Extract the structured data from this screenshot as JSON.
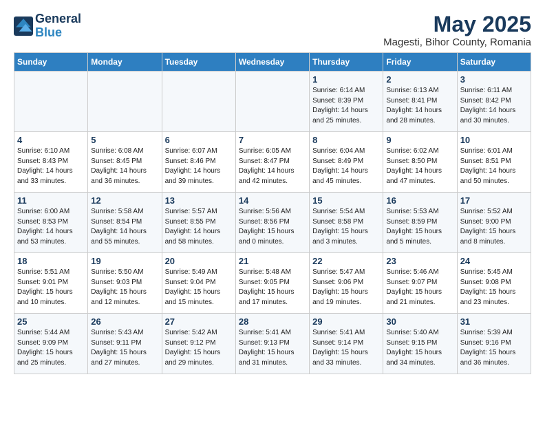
{
  "header": {
    "logo_line1": "General",
    "logo_line2": "Blue",
    "title": "May 2025",
    "subtitle": "Magesti, Bihor County, Romania"
  },
  "weekdays": [
    "Sunday",
    "Monday",
    "Tuesday",
    "Wednesday",
    "Thursday",
    "Friday",
    "Saturday"
  ],
  "weeks": [
    [
      {
        "num": "",
        "info": ""
      },
      {
        "num": "",
        "info": ""
      },
      {
        "num": "",
        "info": ""
      },
      {
        "num": "",
        "info": ""
      },
      {
        "num": "1",
        "info": "Sunrise: 6:14 AM\nSunset: 8:39 PM\nDaylight: 14 hours\nand 25 minutes."
      },
      {
        "num": "2",
        "info": "Sunrise: 6:13 AM\nSunset: 8:41 PM\nDaylight: 14 hours\nand 28 minutes."
      },
      {
        "num": "3",
        "info": "Sunrise: 6:11 AM\nSunset: 8:42 PM\nDaylight: 14 hours\nand 30 minutes."
      }
    ],
    [
      {
        "num": "4",
        "info": "Sunrise: 6:10 AM\nSunset: 8:43 PM\nDaylight: 14 hours\nand 33 minutes."
      },
      {
        "num": "5",
        "info": "Sunrise: 6:08 AM\nSunset: 8:45 PM\nDaylight: 14 hours\nand 36 minutes."
      },
      {
        "num": "6",
        "info": "Sunrise: 6:07 AM\nSunset: 8:46 PM\nDaylight: 14 hours\nand 39 minutes."
      },
      {
        "num": "7",
        "info": "Sunrise: 6:05 AM\nSunset: 8:47 PM\nDaylight: 14 hours\nand 42 minutes."
      },
      {
        "num": "8",
        "info": "Sunrise: 6:04 AM\nSunset: 8:49 PM\nDaylight: 14 hours\nand 45 minutes."
      },
      {
        "num": "9",
        "info": "Sunrise: 6:02 AM\nSunset: 8:50 PM\nDaylight: 14 hours\nand 47 minutes."
      },
      {
        "num": "10",
        "info": "Sunrise: 6:01 AM\nSunset: 8:51 PM\nDaylight: 14 hours\nand 50 minutes."
      }
    ],
    [
      {
        "num": "11",
        "info": "Sunrise: 6:00 AM\nSunset: 8:53 PM\nDaylight: 14 hours\nand 53 minutes."
      },
      {
        "num": "12",
        "info": "Sunrise: 5:58 AM\nSunset: 8:54 PM\nDaylight: 14 hours\nand 55 minutes."
      },
      {
        "num": "13",
        "info": "Sunrise: 5:57 AM\nSunset: 8:55 PM\nDaylight: 14 hours\nand 58 minutes."
      },
      {
        "num": "14",
        "info": "Sunrise: 5:56 AM\nSunset: 8:56 PM\nDaylight: 15 hours\nand 0 minutes."
      },
      {
        "num": "15",
        "info": "Sunrise: 5:54 AM\nSunset: 8:58 PM\nDaylight: 15 hours\nand 3 minutes."
      },
      {
        "num": "16",
        "info": "Sunrise: 5:53 AM\nSunset: 8:59 PM\nDaylight: 15 hours\nand 5 minutes."
      },
      {
        "num": "17",
        "info": "Sunrise: 5:52 AM\nSunset: 9:00 PM\nDaylight: 15 hours\nand 8 minutes."
      }
    ],
    [
      {
        "num": "18",
        "info": "Sunrise: 5:51 AM\nSunset: 9:01 PM\nDaylight: 15 hours\nand 10 minutes."
      },
      {
        "num": "19",
        "info": "Sunrise: 5:50 AM\nSunset: 9:03 PM\nDaylight: 15 hours\nand 12 minutes."
      },
      {
        "num": "20",
        "info": "Sunrise: 5:49 AM\nSunset: 9:04 PM\nDaylight: 15 hours\nand 15 minutes."
      },
      {
        "num": "21",
        "info": "Sunrise: 5:48 AM\nSunset: 9:05 PM\nDaylight: 15 hours\nand 17 minutes."
      },
      {
        "num": "22",
        "info": "Sunrise: 5:47 AM\nSunset: 9:06 PM\nDaylight: 15 hours\nand 19 minutes."
      },
      {
        "num": "23",
        "info": "Sunrise: 5:46 AM\nSunset: 9:07 PM\nDaylight: 15 hours\nand 21 minutes."
      },
      {
        "num": "24",
        "info": "Sunrise: 5:45 AM\nSunset: 9:08 PM\nDaylight: 15 hours\nand 23 minutes."
      }
    ],
    [
      {
        "num": "25",
        "info": "Sunrise: 5:44 AM\nSunset: 9:09 PM\nDaylight: 15 hours\nand 25 minutes."
      },
      {
        "num": "26",
        "info": "Sunrise: 5:43 AM\nSunset: 9:11 PM\nDaylight: 15 hours\nand 27 minutes."
      },
      {
        "num": "27",
        "info": "Sunrise: 5:42 AM\nSunset: 9:12 PM\nDaylight: 15 hours\nand 29 minutes."
      },
      {
        "num": "28",
        "info": "Sunrise: 5:41 AM\nSunset: 9:13 PM\nDaylight: 15 hours\nand 31 minutes."
      },
      {
        "num": "29",
        "info": "Sunrise: 5:41 AM\nSunset: 9:14 PM\nDaylight: 15 hours\nand 33 minutes."
      },
      {
        "num": "30",
        "info": "Sunrise: 5:40 AM\nSunset: 9:15 PM\nDaylight: 15 hours\nand 34 minutes."
      },
      {
        "num": "31",
        "info": "Sunrise: 5:39 AM\nSunset: 9:16 PM\nDaylight: 15 hours\nand 36 minutes."
      }
    ]
  ]
}
